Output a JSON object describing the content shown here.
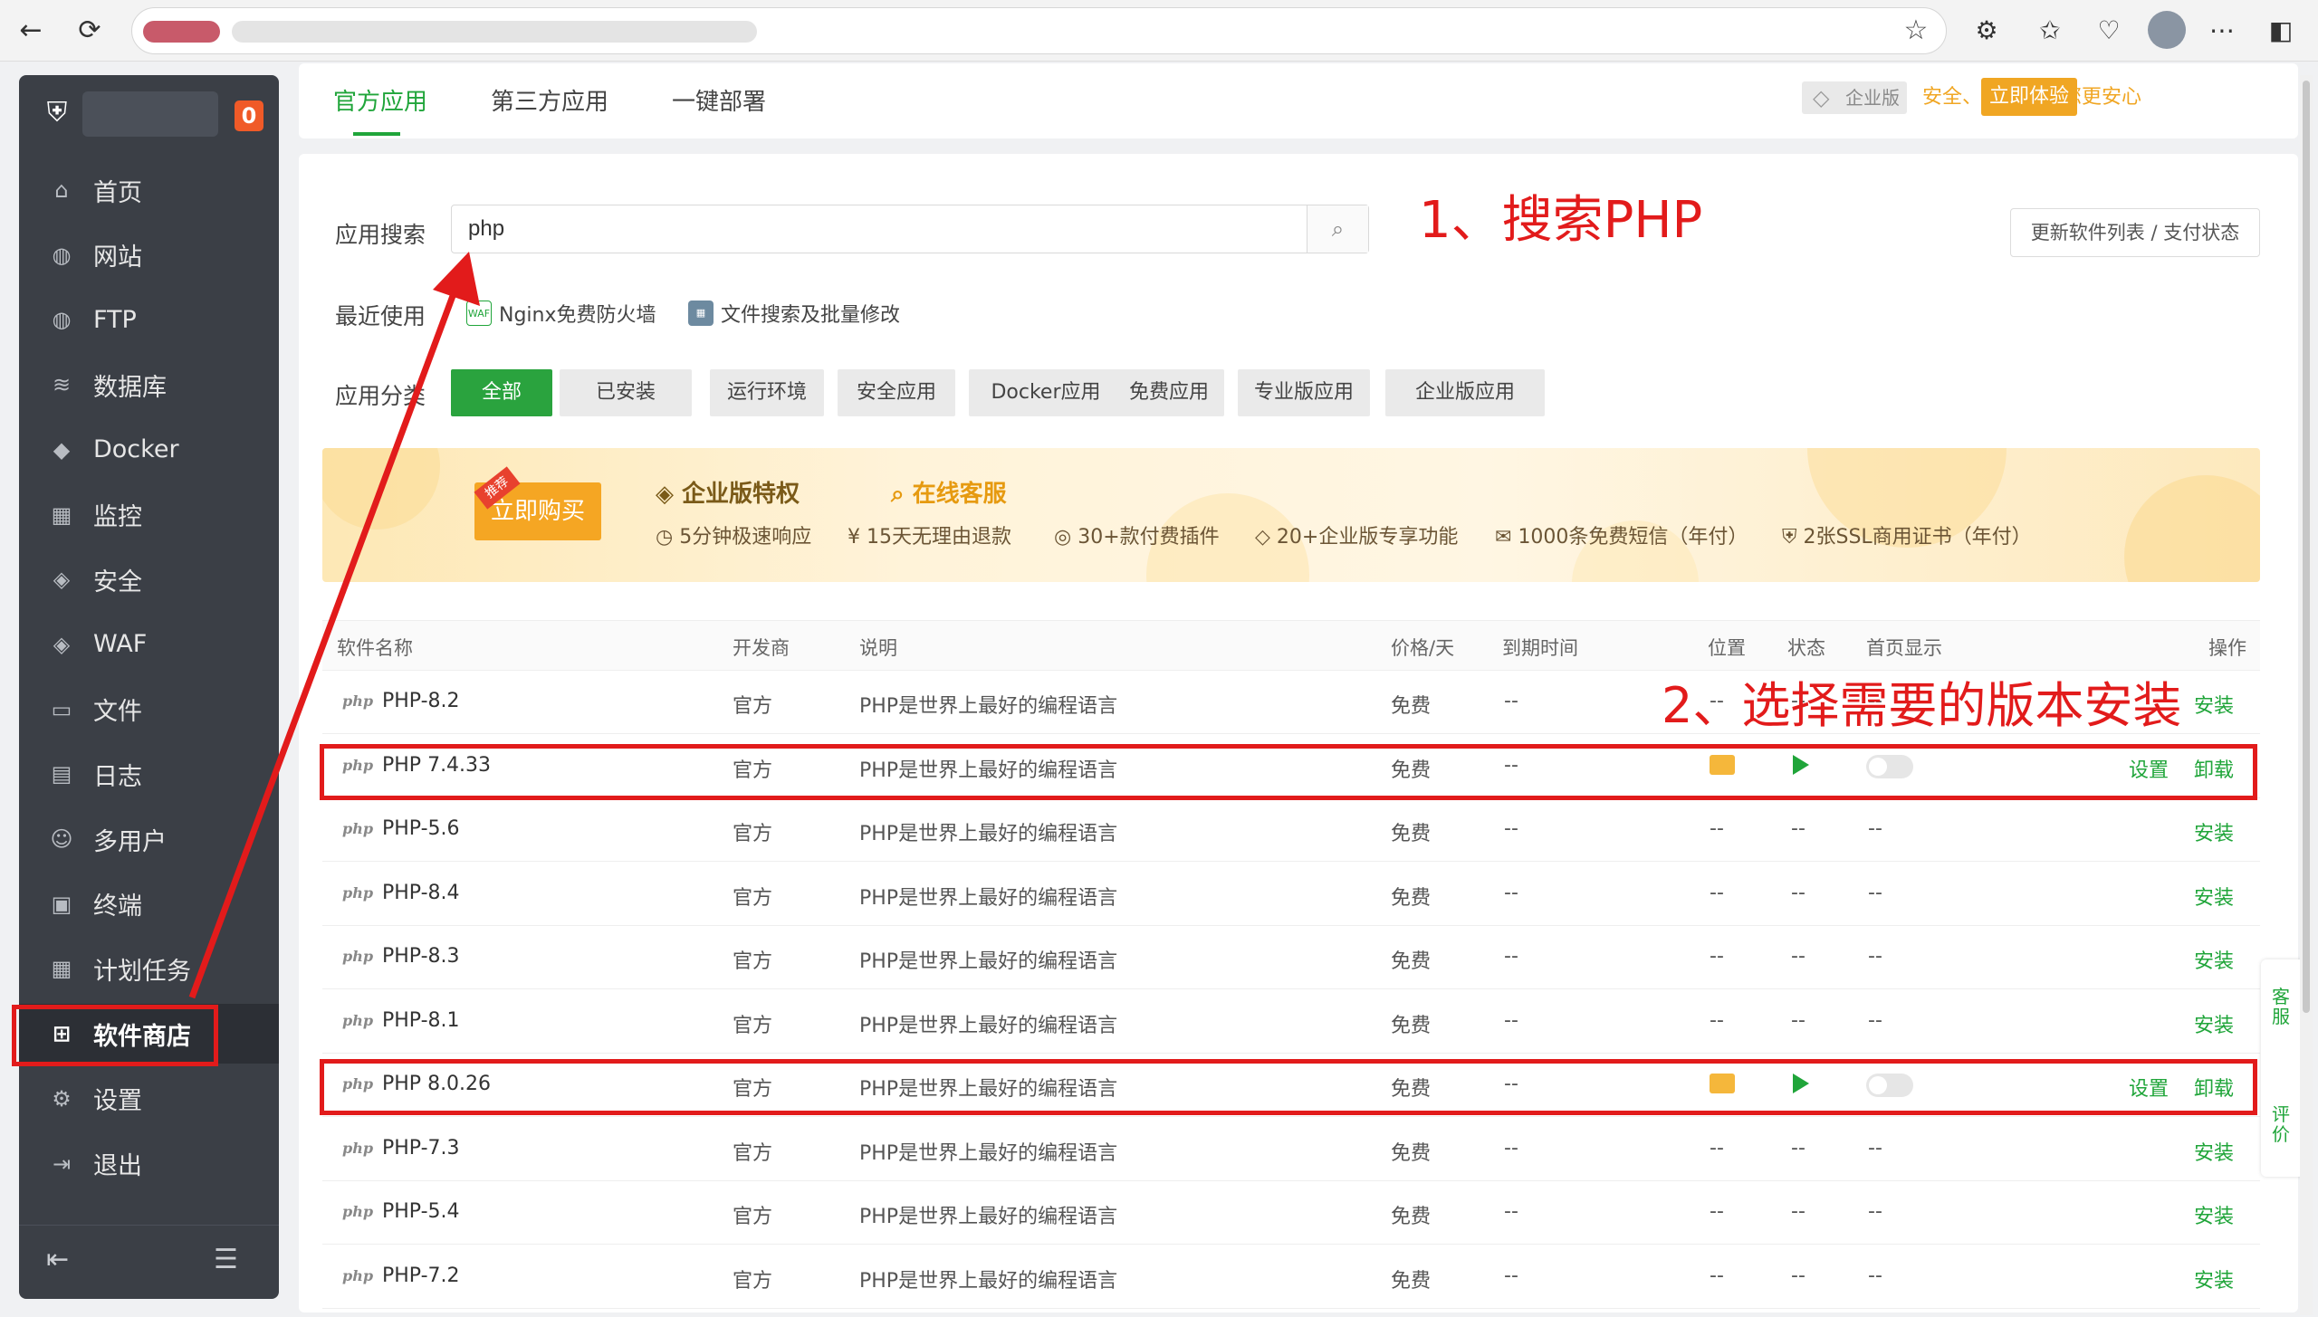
{
  "browser": {
    "back_icon": "←",
    "reload_icon": "⟳",
    "star_icon": "☆"
  },
  "sidebar": {
    "badge": "0",
    "items": [
      {
        "label": "首页",
        "icon": "⌂"
      },
      {
        "label": "网站",
        "icon": "◍"
      },
      {
        "label": "FTP",
        "icon": "◍"
      },
      {
        "label": "数据库",
        "icon": "≋"
      },
      {
        "label": "Docker",
        "icon": "◆"
      },
      {
        "label": "监控",
        "icon": "▦"
      },
      {
        "label": "安全",
        "icon": "◈"
      },
      {
        "label": "WAF",
        "icon": "◈"
      },
      {
        "label": "文件",
        "icon": "▭"
      },
      {
        "label": "日志",
        "icon": "▤"
      },
      {
        "label": "多用户",
        "icon": "☺"
      },
      {
        "label": "终端",
        "icon": "▣"
      },
      {
        "label": "计划任务",
        "icon": "▦"
      },
      {
        "label": "软件商店",
        "icon": "⊞"
      },
      {
        "label": "设置",
        "icon": "⚙"
      },
      {
        "label": "退出",
        "icon": "⇥"
      }
    ],
    "active": "软件商店"
  },
  "topbar": {
    "tabs": [
      "官方应用",
      "第三方应用",
      "一键部署"
    ],
    "enterprise_badge": "企业版",
    "slogan": "安全、高效、让您更安心",
    "trial_button": "立即体验"
  },
  "search": {
    "label": "应用搜索",
    "value": "php"
  },
  "update_button": "更新软件列表 / 支付状态",
  "recent": {
    "label": "最近使用",
    "items": [
      "Nginx免费防火墙",
      "文件搜索及批量修改"
    ]
  },
  "categories": {
    "label": "应用分类",
    "items": [
      "全部",
      "已安装",
      "运行环境",
      "安全应用",
      "Docker应用",
      "免费应用",
      "专业版应用",
      "企业版应用"
    ],
    "active": "全部"
  },
  "banner": {
    "buy_button": "立即购买",
    "buy_tag": "推荐",
    "enterprise_title": "企业版特权",
    "service_title": "在线客服",
    "benefits": [
      "5分钟极速响应",
      "15天无理由退款",
      "30+款付费插件",
      "20+企业版专享功能",
      "1000条免费短信（年付）",
      "2张SSL商用证书（年付）"
    ]
  },
  "table": {
    "columns": [
      "软件名称",
      "开发商",
      "说明",
      "价格/天",
      "到期时间",
      "位置",
      "状态",
      "首页显示",
      "操作"
    ],
    "rows": [
      {
        "name": "PHP-8.2",
        "vendor": "官方",
        "desc": "PHP是世界上最好的编程语言",
        "price": "免费",
        "expire": "--",
        "location": "--",
        "status": "--",
        "home": "--",
        "installed": false,
        "action": "安装"
      },
      {
        "name": "PHP 7.4.33",
        "vendor": "官方",
        "desc": "PHP是世界上最好的编程语言",
        "price": "免费",
        "expire": "--",
        "installed": true,
        "settings": "设置",
        "uninstall": "卸载"
      },
      {
        "name": "PHP-5.6",
        "vendor": "官方",
        "desc": "PHP是世界上最好的编程语言",
        "price": "免费",
        "expire": "--",
        "location": "--",
        "status": "--",
        "home": "--",
        "installed": false,
        "action": "安装"
      },
      {
        "name": "PHP-8.4",
        "vendor": "官方",
        "desc": "PHP是世界上最好的编程语言",
        "price": "免费",
        "expire": "--",
        "location": "--",
        "status": "--",
        "home": "--",
        "installed": false,
        "action": "安装"
      },
      {
        "name": "PHP-8.3",
        "vendor": "官方",
        "desc": "PHP是世界上最好的编程语言",
        "price": "免费",
        "expire": "--",
        "location": "--",
        "status": "--",
        "home": "--",
        "installed": false,
        "action": "安装"
      },
      {
        "name": "PHP-8.1",
        "vendor": "官方",
        "desc": "PHP是世界上最好的编程语言",
        "price": "免费",
        "expire": "--",
        "location": "--",
        "status": "--",
        "home": "--",
        "installed": false,
        "action": "安装"
      },
      {
        "name": "PHP 8.0.26",
        "vendor": "官方",
        "desc": "PHP是世界上最好的编程语言",
        "price": "免费",
        "expire": "--",
        "installed": true,
        "settings": "设置",
        "uninstall": "卸载"
      },
      {
        "name": "PHP-7.3",
        "vendor": "官方",
        "desc": "PHP是世界上最好的编程语言",
        "price": "免费",
        "expire": "--",
        "location": "--",
        "status": "--",
        "home": "--",
        "installed": false,
        "action": "安装"
      },
      {
        "name": "PHP-5.4",
        "vendor": "官方",
        "desc": "PHP是世界上最好的编程语言",
        "price": "免费",
        "expire": "--",
        "location": "--",
        "status": "--",
        "home": "--",
        "installed": false,
        "action": "安装"
      },
      {
        "name": "PHP-7.2",
        "vendor": "官方",
        "desc": "PHP是世界上最好的编程语言",
        "price": "免费",
        "expire": "--",
        "location": "--",
        "status": "--",
        "home": "--",
        "installed": false,
        "action": "安装"
      }
    ]
  },
  "annotations": {
    "step1": "1、搜索PHP",
    "step2": "2、选择需要的版本安装"
  },
  "float": {
    "service": "客服",
    "review": "评价"
  },
  "colors": {
    "accent": "#20a53a",
    "annotation": "#e21b1b",
    "enterprise": "#f0a623",
    "sidebar": "#3b3f46"
  }
}
